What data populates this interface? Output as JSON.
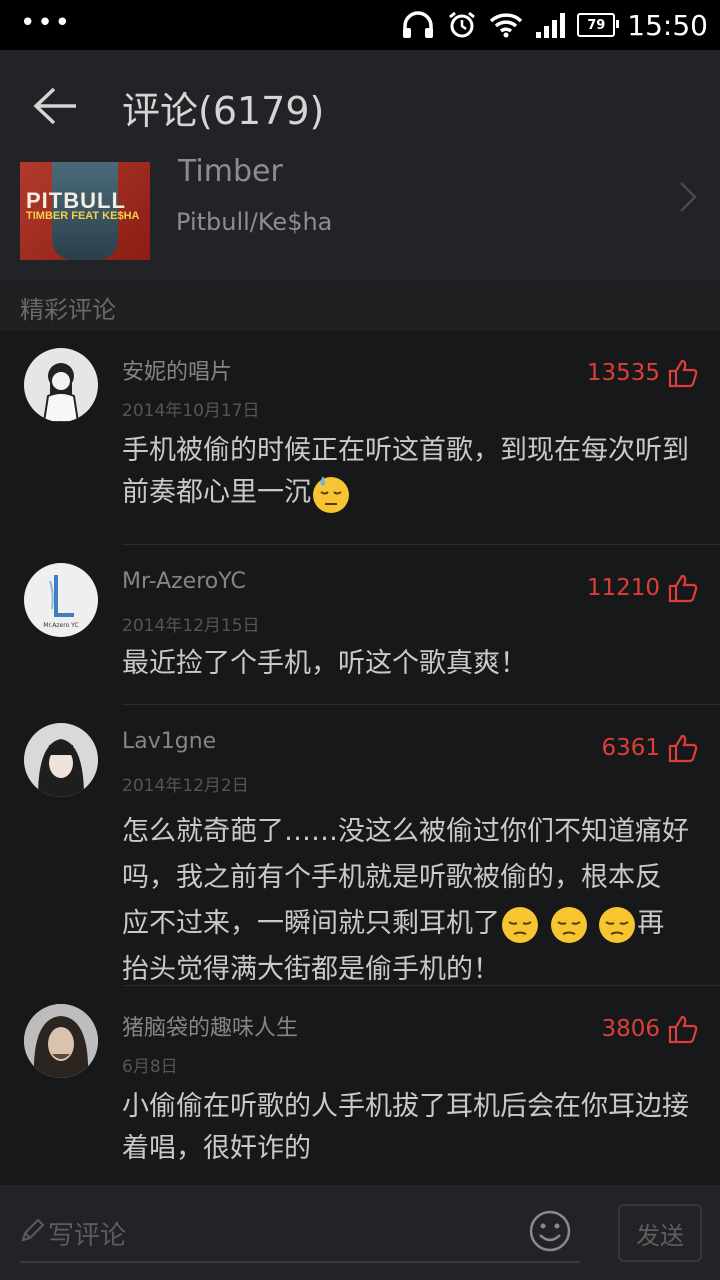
{
  "status_bar": {
    "dots": "•••",
    "battery": "79",
    "time": "15:50"
  },
  "header": {
    "title": "评论(6179)",
    "back_icon": "arrow-left-icon"
  },
  "song": {
    "title": "Timber",
    "artist": "Pitbull/Ke$ha",
    "cover_text_main": "PITBULL",
    "cover_text_sub": "TIMBER FEAT KE$HA"
  },
  "section": {
    "label": "精彩评论"
  },
  "comments": [
    {
      "user": "安妮的唱片",
      "date": "2014年10月17日",
      "likes": "13535",
      "text_parts": [
        "手机被偷的时候正在听这首歌，到现在每次听到前奏都心里一沉"
      ],
      "emoji": [
        "downcast-sweat-emoji"
      ]
    },
    {
      "user": "Mr-AzeroYC",
      "date": "2014年12月15日",
      "likes": "11210",
      "text_parts": [
        "最近捡了个手机，听这个歌真爽！"
      ],
      "avatar_text": "Mr.Azero YC"
    },
    {
      "user": "Lav1gne",
      "date": "2014年12月2日",
      "likes": "6361",
      "text_parts": [
        "怎么就奇葩了……没这么被偷过你们不知道痛好吗，我之前有个手机就是听歌被偷的，根本反",
        "应不过来，一瞬间就只剩耳机了",
        "再",
        "抬头觉得满大街都是偷手机的！"
      ],
      "emoji": [
        "pensive-emoji",
        "pensive-emoji",
        "pensive-emoji"
      ]
    },
    {
      "user": "猪脑袋的趣味人生",
      "date": "6月8日",
      "likes": "3806",
      "text_parts": [
        "小偷偷在听歌的人手机拔了耳机后会在你耳边接着唱，很奸诈的"
      ]
    }
  ],
  "composer": {
    "placeholder": "写评论",
    "send_label": "发送"
  },
  "colors": {
    "accent_red": "#dd3e3a",
    "background": "#17181a"
  }
}
